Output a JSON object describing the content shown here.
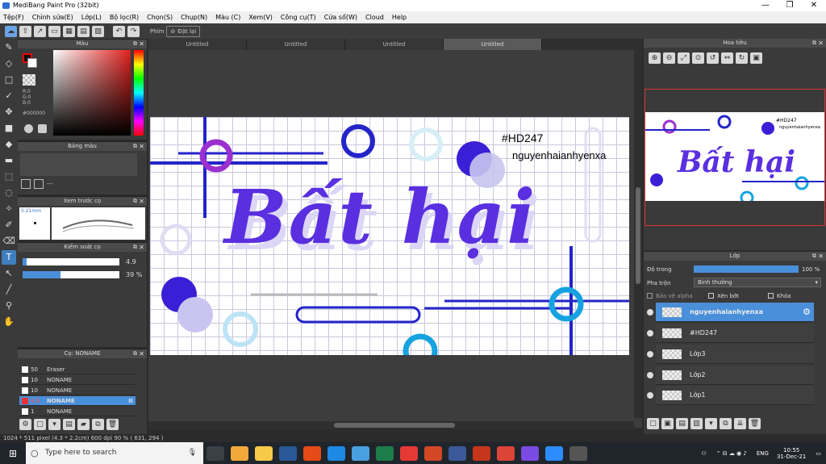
{
  "window": {
    "title": "MediBang Paint Pro (32bit)",
    "minimize": "—",
    "maximize": "❐",
    "close": "✕"
  },
  "menu": [
    "Tệp(F)",
    "Chỉnh sửa(E)",
    "Lớp(L)",
    "Bộ lọc(R)",
    "Chọn(S)",
    "Chụp(N)",
    "Màu (C)",
    "Xem(V)",
    "Công cụ(T)",
    "Cửa sổ(W)",
    "Cloud",
    "Help"
  ],
  "toolbar": {
    "shortcut_label": "Phím",
    "reset_label": "Đặt lại"
  },
  "tabs": [
    "Untitled",
    "Untitled",
    "Untitled",
    "Untitled"
  ],
  "color_panel": {
    "title": "Màu",
    "r": "R:0",
    "g": "G:0",
    "b": "B:0",
    "hex": "#000000"
  },
  "palette_panel": {
    "title": "Bảng màu",
    "dash": "---"
  },
  "preview_panel": {
    "title": "Xem trước cọ",
    "size": "0.21mm"
  },
  "brush_control": {
    "title": "Kiểm soát cọ",
    "size_value": "4.9",
    "opacity_value": "39 %",
    "size_fraction": 0.04,
    "opacity_fraction": 0.39
  },
  "brush_list": {
    "title": "Cọ: NONAME",
    "rows": [
      {
        "size": "50",
        "name": "Eraser"
      },
      {
        "size": "10",
        "name": "NONAME"
      },
      {
        "size": "10",
        "name": "NONAME"
      },
      {
        "size": "4.9",
        "name": "NONAME"
      },
      {
        "size": "1",
        "name": "NONAME"
      }
    ]
  },
  "canvas_art": {
    "tag": "#HD247",
    "author": "nguyenhaianhyenxa",
    "headline": "Bất hại"
  },
  "navigator": {
    "title": "Hoa tiêu"
  },
  "layers_panel": {
    "title": "Lớp",
    "opacity_label": "Độ trong",
    "opacity_value": "100 %",
    "opacity_fraction": 1.0,
    "blend_label": "Pha trộn",
    "blend_value": "Bình thường",
    "protect_alpha": "Bảo vệ alpha",
    "clipping": "Xén bớt",
    "lock": "Khóa",
    "layers": [
      "nguyenhaianhyenxa",
      "#HD247",
      "Lớp3",
      "Lớp2",
      "Lớp1"
    ]
  },
  "status_bar": "1024 * 511 pixel   (4.3 * 2.2cm)   600 dpi   90 %   ( 631, 294 )",
  "taskbar": {
    "search_placeholder": "Type here to search",
    "lang": "ENG",
    "time": "10:55",
    "date": "31-Dec-21"
  }
}
